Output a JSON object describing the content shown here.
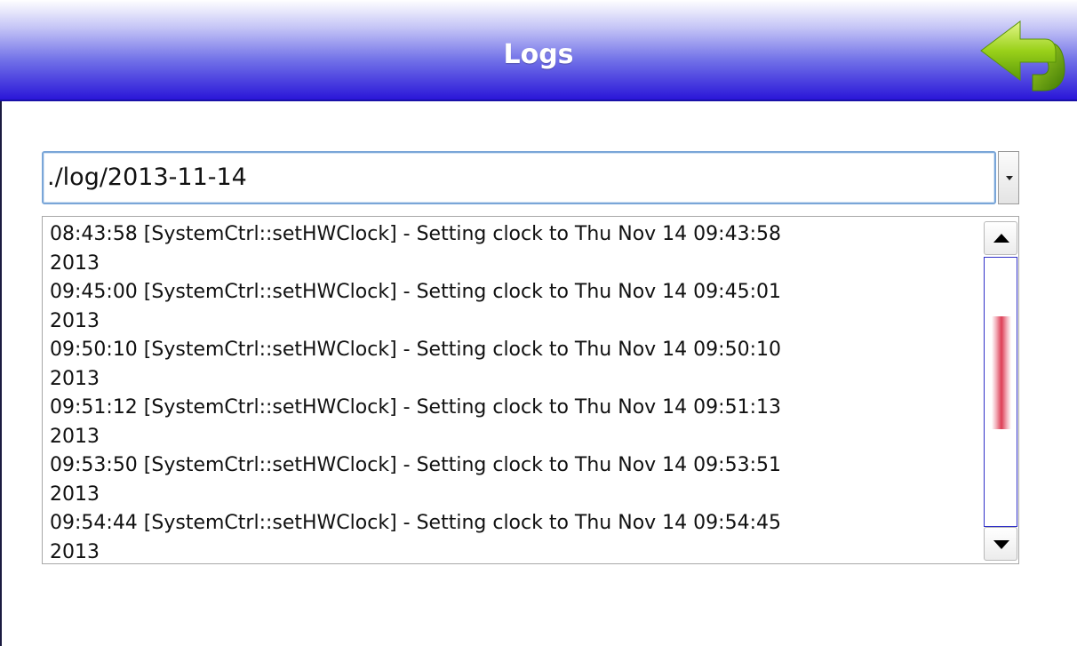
{
  "header": {
    "title": "Logs",
    "back_icon": "back-arrow-icon",
    "accent_color": "#2a16d8"
  },
  "log_selector": {
    "selected_value": "./log/2013-11-14"
  },
  "log_view": {
    "lines": [
      "08:43:58 [SystemCtrl::setHWClock] - Setting clock to Thu Nov 14 09:43:58",
      "2013",
      "09:45:00 [SystemCtrl::setHWClock] - Setting clock to Thu Nov 14 09:45:01",
      "2013",
      "09:50:10 [SystemCtrl::setHWClock] - Setting clock to Thu Nov 14 09:50:10",
      "2013",
      "09:51:12 [SystemCtrl::setHWClock] - Setting clock to Thu Nov 14 09:51:13",
      "2013",
      "09:53:50 [SystemCtrl::setHWClock] - Setting clock to Thu Nov 14 09:53:51",
      "2013",
      "09:54:44 [SystemCtrl::setHWClock] - Setting clock to Thu Nov 14 09:54:45",
      "2013"
    ],
    "scroll": {
      "thumb_start_fraction": 0.22,
      "thumb_size_fraction": 0.42,
      "thumb_color": "#dd3e56",
      "up_icon": "scroll-up-arrow-icon",
      "down_icon": "scroll-down-arrow-icon"
    }
  }
}
